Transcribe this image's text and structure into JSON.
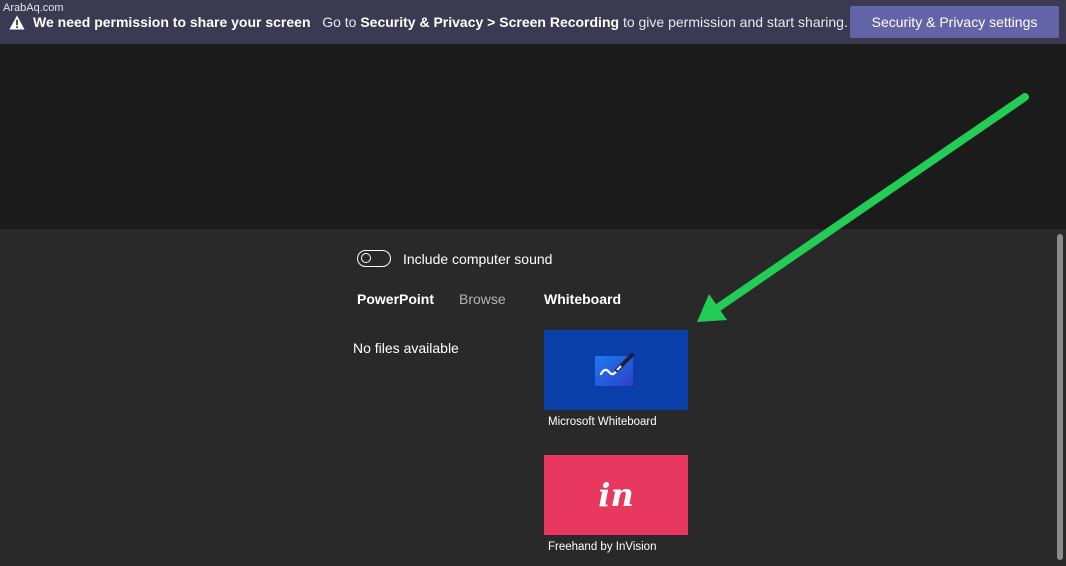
{
  "watermark": "ArabAq.com",
  "banner": {
    "bold_text": "We need permission to share your screen",
    "text_prefix": "Go to ",
    "path_bold": "Security & Privacy > Screen Recording",
    "text_suffix": " to give permission and start sharing.",
    "button_label": "Security & Privacy settings"
  },
  "sound": {
    "label": "Include computer sound",
    "enabled": false
  },
  "sections": {
    "powerpoint": "PowerPoint",
    "browse": "Browse",
    "whiteboard": "Whiteboard"
  },
  "powerpoint_empty": "No files available",
  "whiteboard_apps": [
    {
      "label": "Microsoft Whiteboard",
      "icon": "microsoft-whiteboard-icon"
    },
    {
      "label": "Freehand by InVision",
      "icon": "invision-icon",
      "logo_text": "in"
    }
  ],
  "colors": {
    "banner_bg": "#3b3a52",
    "accent": "#6264a7",
    "whiteboard_tile": "#0a3ea8",
    "invision_tile": "#e8385f",
    "annotation_arrow": "#22cc55"
  }
}
